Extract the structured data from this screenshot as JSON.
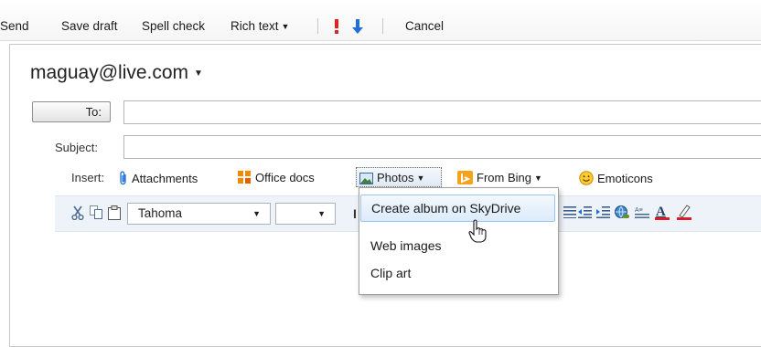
{
  "toolbar": {
    "send": "Send",
    "save_draft": "Save draft",
    "spell_check": "Spell check",
    "rich_text": "Rich text",
    "cancel": "Cancel",
    "high_importance_icon": "exclamation-icon",
    "low_importance_icon": "down-arrow-icon"
  },
  "compose": {
    "from": "maguay@live.com",
    "to_button": "To:",
    "to_value": "",
    "subject_label": "Subject:",
    "subject_value": ""
  },
  "insert": {
    "label": "Insert:",
    "attachments": "Attachments",
    "office_docs": "Office docs",
    "photos": "Photos",
    "from_bing": "From Bing",
    "emoticons": "Emoticons"
  },
  "format": {
    "font": "Tahoma",
    "size": "",
    "bold_partial": "I"
  },
  "photos_menu": {
    "items": [
      "Create album on SkyDrive",
      "Web images",
      "Clip art"
    ],
    "highlighted_index": 0
  },
  "colors": {
    "accent_blue": "#1e6fd9",
    "office_orange": "#f08a00",
    "bing_orange": "#f5a31a",
    "highlight_bg": "#dcebfb",
    "importance_red": "#e22020"
  }
}
